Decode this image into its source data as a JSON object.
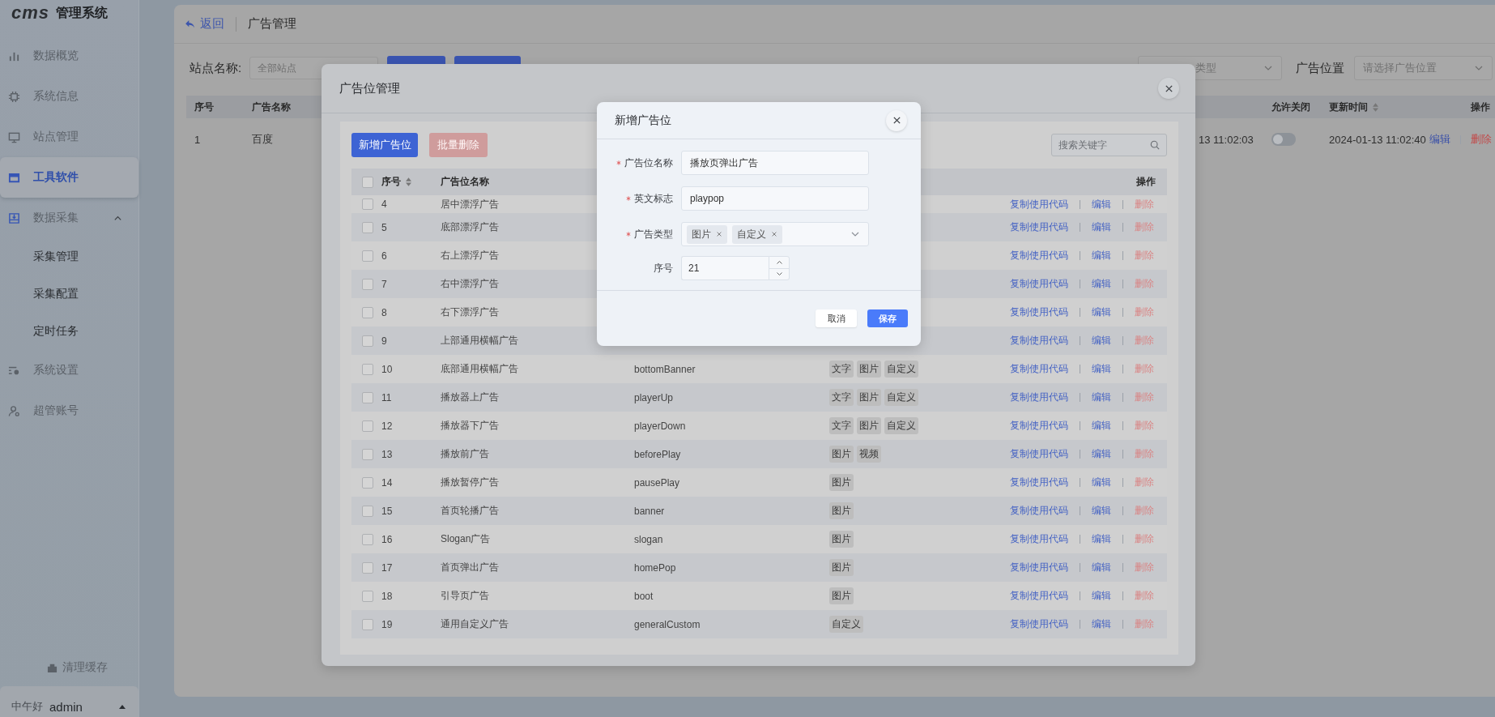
{
  "sidebar": {
    "logo": "cms",
    "title": "管理系统",
    "items": [
      {
        "label": "数据概览",
        "selected": false
      },
      {
        "label": "系统信息",
        "selected": false
      },
      {
        "label": "站点管理",
        "selected": false
      },
      {
        "label": "工具软件",
        "selected": true
      },
      {
        "label": "数据采集",
        "selected": false,
        "expanded": true,
        "children": [
          {
            "label": "采集管理",
            "selected": false
          },
          {
            "label": "采集配置",
            "selected": false
          },
          {
            "label": "定时任务",
            "selected": false
          }
        ]
      },
      {
        "label": "系统设置",
        "selected": false
      },
      {
        "label": "超管账号",
        "selected": false
      }
    ],
    "clear_cache": "清理缓存",
    "user": {
      "greeting": "中午好",
      "name": "admin"
    }
  },
  "page": {
    "back": "返回",
    "title": "广告管理",
    "filters": {
      "site_label": "站点名称:",
      "site_placeholder": "全部站点",
      "type_placeholder": "类型",
      "position_label": "广告位置",
      "position_placeholder": "请选择广告位置"
    },
    "table": {
      "columns": [
        "序号",
        "广告名称",
        "允许关闭",
        "更新时间",
        "操作"
      ],
      "rows": [
        {
          "no": "1",
          "name": "百度",
          "column_3": "13 11:02:03",
          "allow_close_on": false,
          "updated": "2024-01-13 11:02:40",
          "actions": [
            "编辑",
            "删除"
          ]
        }
      ]
    }
  },
  "manager_modal": {
    "title": "广告位管理",
    "add_button": "新增广告位",
    "batch_delete_button": "批量删除",
    "batch_delete_disabled": true,
    "search_placeholder": "搜索关键字",
    "select_all_checked": false,
    "columns": [
      "序号",
      "广告位名称",
      "操作"
    ],
    "rows": [
      {
        "no": "4",
        "name": "居中漂浮广告",
        "checked": false,
        "actions": [
          "复制使用代码",
          "编辑",
          "删除"
        ]
      },
      {
        "no": "5",
        "name": "底部漂浮广告",
        "checked": false,
        "actions": [
          "复制使用代码",
          "编辑",
          "删除"
        ]
      },
      {
        "no": "6",
        "name": "右上漂浮广告",
        "checked": false,
        "actions": [
          "复制使用代码",
          "编辑",
          "删除"
        ]
      },
      {
        "no": "7",
        "name": "右中漂浮广告",
        "checked": false,
        "actions": [
          "复制使用代码",
          "编辑",
          "删除"
        ]
      },
      {
        "no": "8",
        "name": "右下漂浮广告",
        "checked": false,
        "actions": [
          "复制使用代码",
          "编辑",
          "删除"
        ]
      },
      {
        "no": "9",
        "name": "上部通用横幅广告",
        "checked": false,
        "actions": [
          "复制使用代码",
          "编辑",
          "删除"
        ]
      },
      {
        "no": "10",
        "name": "底部通用横幅广告",
        "code": "bottomBanner",
        "types": [
          "文字",
          "图片",
          "自定义"
        ],
        "checked": false,
        "actions": [
          "复制使用代码",
          "编辑",
          "删除"
        ]
      },
      {
        "no": "11",
        "name": "播放器上广告",
        "code": "playerUp",
        "types": [
          "文字",
          "图片",
          "自定义"
        ],
        "checked": false,
        "actions": [
          "复制使用代码",
          "编辑",
          "删除"
        ]
      },
      {
        "no": "12",
        "name": "播放器下广告",
        "code": "playerDown",
        "types": [
          "文字",
          "图片",
          "自定义"
        ],
        "checked": false,
        "actions": [
          "复制使用代码",
          "编辑",
          "删除"
        ]
      },
      {
        "no": "13",
        "name": "播放前广告",
        "code": "beforePlay",
        "types": [
          "图片",
          "视频"
        ],
        "checked": false,
        "actions": [
          "复制使用代码",
          "编辑",
          "删除"
        ]
      },
      {
        "no": "14",
        "name": "播放暂停广告",
        "code": "pausePlay",
        "types": [
          "图片"
        ],
        "checked": false,
        "actions": [
          "复制使用代码",
          "编辑",
          "删除"
        ]
      },
      {
        "no": "15",
        "name": "首页轮播广告",
        "code": "banner",
        "types": [
          "图片"
        ],
        "checked": false,
        "actions": [
          "复制使用代码",
          "编辑",
          "删除"
        ]
      },
      {
        "no": "16",
        "name": "Slogan广告",
        "code": "slogan",
        "types": [
          "图片"
        ],
        "checked": false,
        "actions": [
          "复制使用代码",
          "编辑",
          "删除"
        ]
      },
      {
        "no": "17",
        "name": "首页弹出广告",
        "code": "homePop",
        "types": [
          "图片"
        ],
        "checked": false,
        "actions": [
          "复制使用代码",
          "编辑",
          "删除"
        ]
      },
      {
        "no": "18",
        "name": "引导页广告",
        "code": "boot",
        "types": [
          "图片"
        ],
        "checked": false,
        "actions": [
          "复制使用代码",
          "编辑",
          "删除"
        ]
      },
      {
        "no": "19",
        "name": "通用自定义广告",
        "code": "generalCustom",
        "types": [
          "自定义"
        ],
        "checked": false,
        "actions": [
          "复制使用代码",
          "编辑",
          "删除"
        ]
      }
    ]
  },
  "dialog": {
    "title": "新增广告位",
    "fields": [
      {
        "kind": "text",
        "label": "广告位名称",
        "required": true,
        "value": "播放页弹出广告"
      },
      {
        "kind": "text",
        "label": "英文标志",
        "required": true,
        "value": "playpop"
      },
      {
        "kind": "tags",
        "label": "广告类型",
        "required": true,
        "tags": [
          "图片",
          "自定义"
        ]
      },
      {
        "kind": "number",
        "label": "序号",
        "required": false,
        "value": "21"
      }
    ],
    "cancel": "取消",
    "save": "保存"
  }
}
